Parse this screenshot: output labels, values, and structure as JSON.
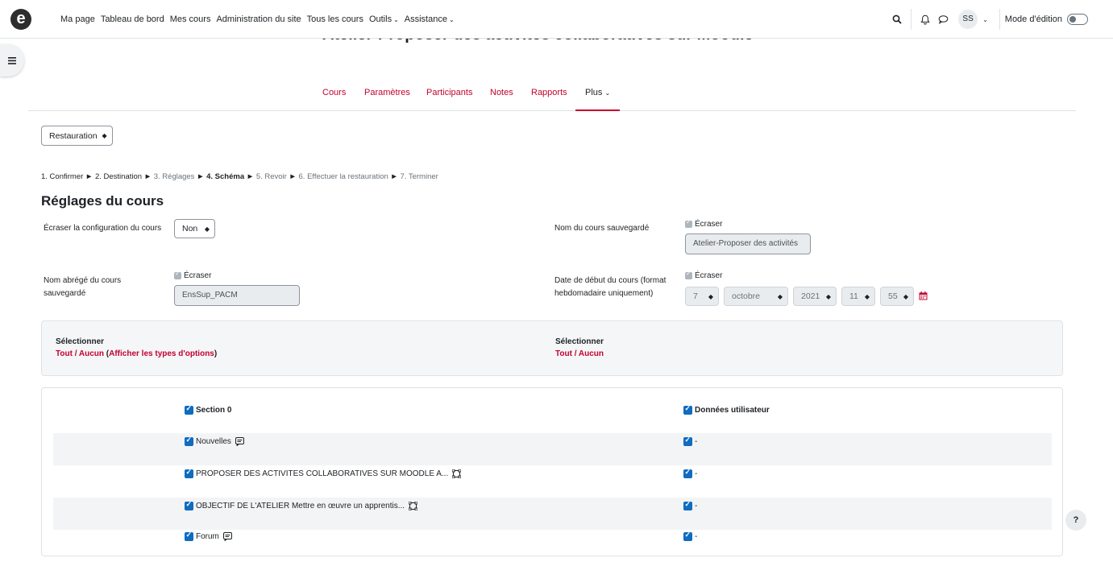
{
  "navbar": {
    "logo_letter": "e",
    "links": [
      "Ma page",
      "Tableau de bord",
      "Mes cours",
      "Administration du site",
      "Tous les cours",
      "Outils",
      "Assistance"
    ],
    "avatar_initials": "SS",
    "edit_mode_label": "Mode d'édition",
    "edit_mode_on": false
  },
  "course": {
    "title": "Atelier-Proposer des activités collaboratives sur Moodle"
  },
  "tabs": [
    "Cours",
    "Paramètres",
    "Participants",
    "Notes",
    "Rapports",
    "Plus"
  ],
  "active_tab": "Plus",
  "action_select": "Restauration",
  "breadcrumb": {
    "steps": [
      "1. Confirmer",
      "2. Destination",
      "3. Réglages",
      "4. Schéma",
      "5. Revoir",
      "6. Effectuer la restauration",
      "7. Terminer"
    ],
    "separator": "►",
    "current": "4. Schéma"
  },
  "heading": "Réglages du cours",
  "fields": {
    "overwrite_config_label": "Écraser la configuration du cours",
    "overwrite_config_value": "Non",
    "course_name_label": "Nom du cours sauvegardé",
    "course_name_overwrite": "Écraser",
    "course_name_value": "Atelier-Proposer des activités",
    "short_name_label": "Nom abrégé du cours sauvegardé",
    "short_name_overwrite": "Écraser",
    "short_name_value": "EnsSup_PACM",
    "start_date_label": "Date de début du cours (format hebdomadaire uniquement)",
    "start_date_overwrite": "Écraser",
    "start_date": {
      "day": "7",
      "month": "octobre",
      "year": "2021",
      "hour": "11",
      "minute": "55"
    }
  },
  "select_panel": {
    "left_title": "Sélectionner",
    "all": "Tout",
    "slash": "/",
    "none": "Aucun",
    "show_types": "Afficher les types d'options",
    "right_title": "Sélectionner"
  },
  "items": {
    "header_left": "Section 0",
    "header_right": "Données utilisateur",
    "rows": [
      {
        "label": "Nouvelles",
        "icon": "forum-icon",
        "right": "-"
      },
      {
        "label": "PROPOSER DES ACTIVITES COLLABORATIVES SUR MOODLE A...",
        "icon": "label-icon",
        "right": "-"
      },
      {
        "label": "OBJECTIF DE L'ATELIER Mettre en œuvre un apprentis...",
        "icon": "label-icon",
        "right": "-"
      },
      {
        "label": "Forum",
        "icon": "forum-icon",
        "right": "-"
      }
    ]
  },
  "help_label": "?",
  "colors": {
    "accent": "#c3002f",
    "checkbox": "#0f6cbf",
    "panel_bg": "#f5f6f7"
  }
}
